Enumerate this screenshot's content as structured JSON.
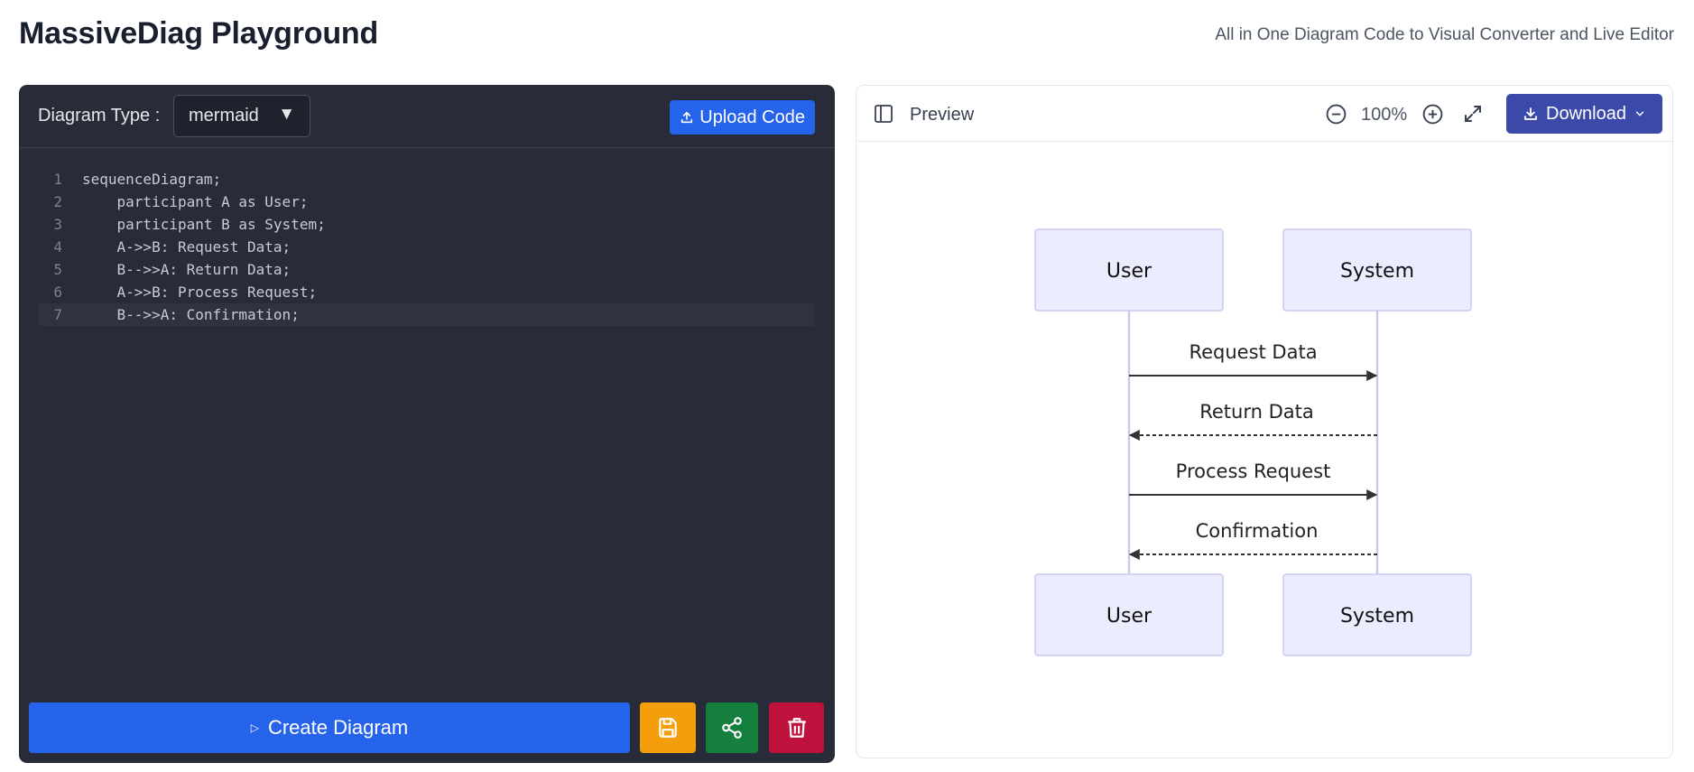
{
  "header": {
    "title": "MassiveDiag Playground",
    "subtitle": "All in One Diagram Code to Visual Converter and Live Editor"
  },
  "editor": {
    "diagram_type_label": "Diagram Type :",
    "diagram_type_value": "mermaid",
    "upload_label": "Upload Code",
    "active_line": 7,
    "lines": [
      {
        "num": "1",
        "text": "sequenceDiagram;"
      },
      {
        "num": "2",
        "text": "    participant A as User;"
      },
      {
        "num": "3",
        "text": "    participant B as System;"
      },
      {
        "num": "4",
        "text": "    A->>B: Request Data;"
      },
      {
        "num": "5",
        "text": "    B-->>A: Return Data;"
      },
      {
        "num": "6",
        "text": "    A->>B: Process Request;"
      },
      {
        "num": "7",
        "text": "    B-->>A: Confirmation;"
      }
    ],
    "create_label": "Create Diagram"
  },
  "preview": {
    "label": "Preview",
    "zoom": "100%",
    "download_label": "Download"
  },
  "diagram": {
    "participants": [
      "User",
      "System"
    ],
    "messages": [
      {
        "from": "User",
        "to": "System",
        "label": "Request Data",
        "style": "solid"
      },
      {
        "from": "System",
        "to": "User",
        "label": "Return Data",
        "style": "dashed"
      },
      {
        "from": "User",
        "to": "System",
        "label": "Process Request",
        "style": "solid"
      },
      {
        "from": "System",
        "to": "User",
        "label": "Confirmation",
        "style": "dashed"
      }
    ]
  },
  "colors": {
    "primary": "#2563eb",
    "editor_bg": "#282c38",
    "save": "#f59e0b",
    "share": "#15803d",
    "delete": "#be123c",
    "download": "#3b4aa8",
    "actor_fill": "#ececff",
    "actor_stroke": "#c9c9f2"
  },
  "icons": {
    "upload": "upload-icon",
    "play": "play-icon",
    "save": "floppy-disk-icon",
    "share": "share-icon",
    "delete": "trash-icon",
    "sidebar": "sidebar-panel-icon",
    "zoom_out": "zoom-out-icon",
    "zoom_in": "zoom-in-icon",
    "fullscreen": "expand-icon",
    "download": "download-icon",
    "chevron": "chevron-down-icon"
  }
}
